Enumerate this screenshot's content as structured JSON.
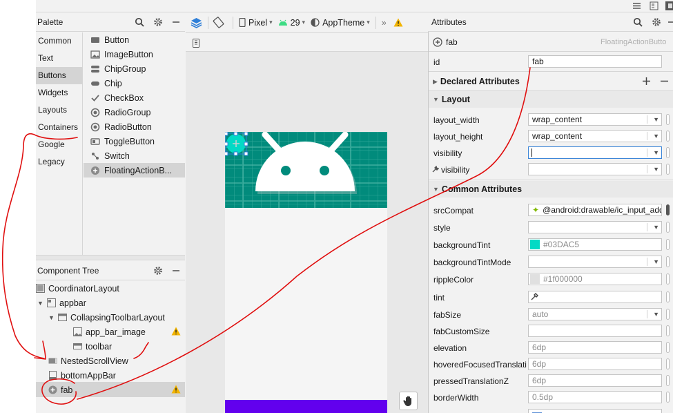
{
  "palette": {
    "title": "Palette",
    "categories": [
      "Common",
      "Text",
      "Buttons",
      "Widgets",
      "Layouts",
      "Containers",
      "Google",
      "Legacy"
    ],
    "selected_category": "Buttons",
    "items": [
      {
        "label": "Button",
        "icon": "button-icon"
      },
      {
        "label": "ImageButton",
        "icon": "image-button-icon"
      },
      {
        "label": "ChipGroup",
        "icon": "chip-group-icon"
      },
      {
        "label": "Chip",
        "icon": "chip-icon"
      },
      {
        "label": "CheckBox",
        "icon": "checkmark-icon"
      },
      {
        "label": "RadioGroup",
        "icon": "radio-group-icon"
      },
      {
        "label": "RadioButton",
        "icon": "radio-button-icon"
      },
      {
        "label": "ToggleButton",
        "icon": "toggle-button-icon"
      },
      {
        "label": "Switch",
        "icon": "switch-icon"
      },
      {
        "label": "FloatingActionB...",
        "icon": "fab-icon"
      }
    ]
  },
  "component_tree": {
    "title": "Component Tree",
    "nodes": [
      {
        "label": "CoordinatorLayout",
        "warn": false
      },
      {
        "label": "appbar",
        "warn": false
      },
      {
        "label": "CollapsingToolbarLayout",
        "warn": false
      },
      {
        "label": "app_bar_image",
        "warn": true
      },
      {
        "label": "toolbar",
        "warn": false
      },
      {
        "label": "NestedScrollView",
        "warn": false
      },
      {
        "label": "bottomAppBar",
        "warn": false
      },
      {
        "label": "fab",
        "warn": true
      }
    ]
  },
  "toolbar": {
    "device": "Pixel",
    "api": "29",
    "theme": "AppTheme",
    "more": "»"
  },
  "attributes": {
    "title": "Attributes",
    "component_name": "fab",
    "component_class": "FloatingActionButto",
    "id_label": "id",
    "id_value": "fab",
    "declared_section": "Declared Attributes",
    "layout_section": "Layout",
    "layout_rows": [
      {
        "label": "layout_width",
        "value": "wrap_content"
      },
      {
        "label": "layout_height",
        "value": "wrap_content"
      },
      {
        "label": "visibility",
        "value": ""
      },
      {
        "label": "visibility",
        "value": ""
      }
    ],
    "common_section": "Common Attributes",
    "common_rows": [
      {
        "label": "srcCompat",
        "value": "@android:drawable/ic_input_add"
      },
      {
        "label": "style",
        "value": ""
      },
      {
        "label": "backgroundTint",
        "value": "#03DAC5"
      },
      {
        "label": "backgroundTintMode",
        "value": ""
      },
      {
        "label": "rippleColor",
        "value": "#1f000000"
      },
      {
        "label": "tint",
        "value": ""
      },
      {
        "label": "fabSize",
        "value": "auto"
      },
      {
        "label": "fabCustomSize",
        "value": ""
      },
      {
        "label": "elevation",
        "value": "6dp"
      },
      {
        "label": "hoveredFocusedTranslati...",
        "value": "6dp"
      },
      {
        "label": "pressedTranslationZ",
        "value": "6dp"
      },
      {
        "label": "borderWidth",
        "value": "0.5dp"
      }
    ]
  },
  "colors": {
    "background_tint": "#03DAC5",
    "ripple": "#e0e0e0",
    "header": "#018B7C",
    "bottom_bar": "#6200EE",
    "annotation": "#e01010"
  }
}
